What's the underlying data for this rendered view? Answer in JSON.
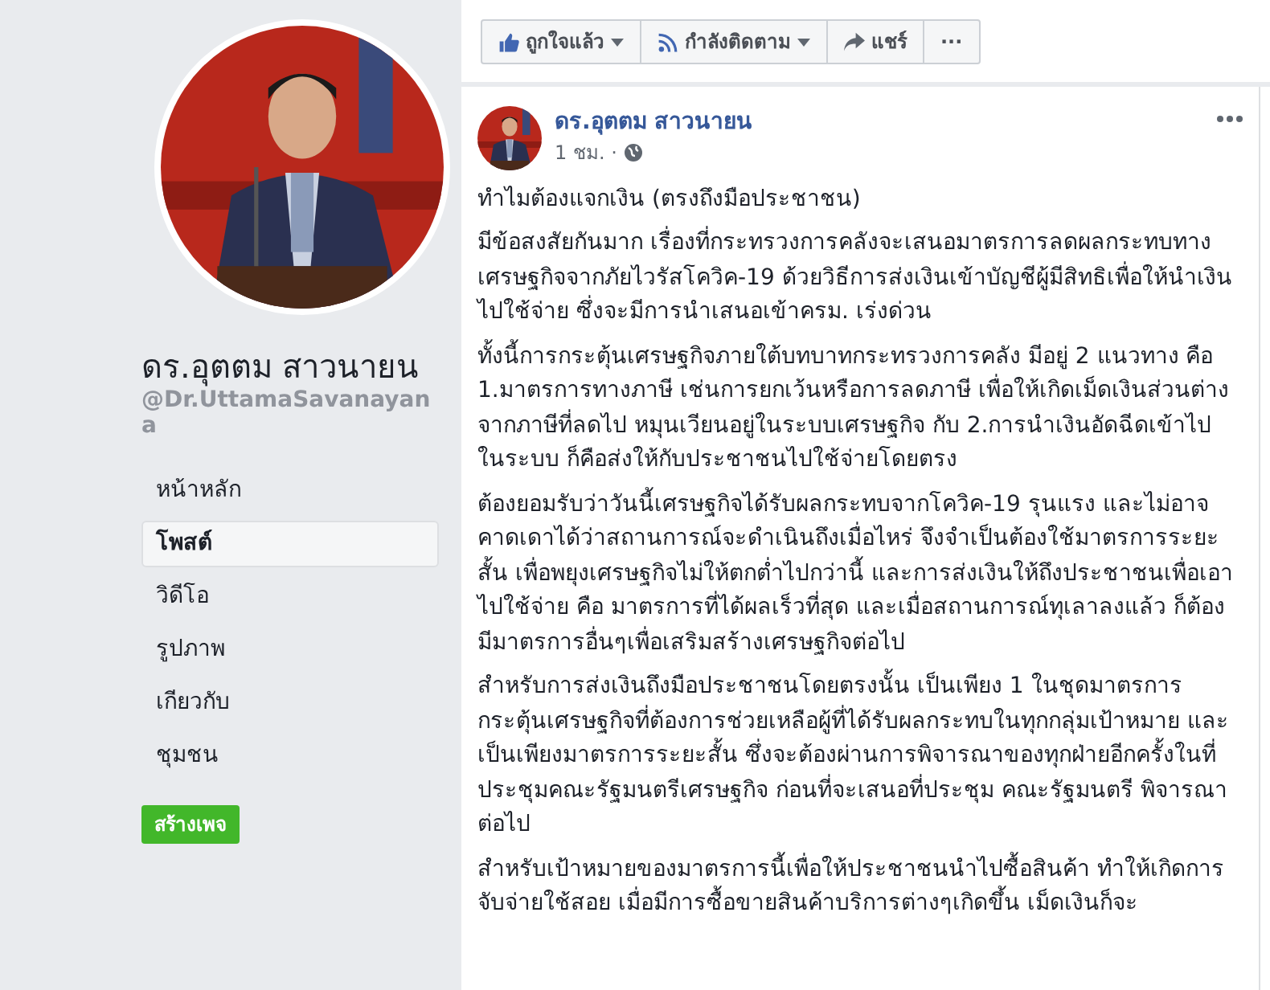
{
  "profile": {
    "name": "ดร.อุตตม สาวนายน",
    "handle": "@Dr.UttamaSavanayana"
  },
  "nav": [
    {
      "label": "หน้าหลัก",
      "selected": false
    },
    {
      "label": "โพสต์",
      "selected": true
    },
    {
      "label": "วิดีโอ",
      "selected": false
    },
    {
      "label": "รูปภาพ",
      "selected": false
    },
    {
      "label": "เกียวกับ",
      "selected": false
    },
    {
      "label": "ชุมชน",
      "selected": false
    }
  ],
  "create_page_button": "สร้างเพจ",
  "actions": [
    {
      "kind": "like",
      "label": "ถูกใจแล้ว",
      "dropdown": true
    },
    {
      "kind": "follow",
      "label": "กำลังติดตาม",
      "dropdown": true
    },
    {
      "kind": "share",
      "label": "แชร์",
      "dropdown": false
    },
    {
      "kind": "more",
      "label": "···",
      "dropdown": false
    }
  ],
  "post": {
    "author": "ดร.อุตตม สาวนายน",
    "time": "1 ชม. ·",
    "title": "ทำไมต้องแจกเงิน (ตรงถึงมือประชาชน)",
    "paragraphs": [
      "มีข้อสงสัยกันมาก เรื่องที่กระทรวงการคลังจะเสนอมาตรการลดผลกระทบทางเศรษฐกิจจากภัยไวรัสโควิค-19 ด้วยวิธีการส่งเงินเข้าบัญชีผู้มีสิทธิเพื่อให้นำเงินไปใช้จ่าย ซึ่งจะมีการนำเสนอเข้าครม. เร่งด่วน",
      "ทั้งนี้การกระตุ้นเศรษฐกิจภายใต้บทบาทกระทรวงการคลัง มีอยู่ 2 แนวทาง คือ 1.มาตรการทางภาษี เช่นการยกเว้นหรือการลดภาษี เพื่อให้เกิดเม็ดเงินส่วนต่างจากภาษีที่ลดไป หมุนเวียนอยู่ในระบบเศรษฐกิจ กับ 2.การนำเงินอัดฉีดเข้าไปในระบบ ก็คือส่งให้กับประชาชนไปใช้จ่ายโดยตรง",
      "ต้องยอมรับว่าวันนี้เศรษฐกิจได้รับผลกระทบจากโควิค-19 รุนแรง และไม่อาจคาดเดาได้ว่าสถานการณ์จะดำเนินถึงเมื่อไหร่ จึงจำเป็นต้องใช้มาตรการระยะสั้น เพื่อพยุงเศรษฐกิจไม่ให้ตกต่ำไปกว่านี้ และการส่งเงินให้ถึงประชาชนเพื่อเอาไปใช้จ่าย คือ มาตรการที่ได้ผลเร็วที่สุด และเมื่อสถานการณ์ทุเลาลงแล้ว ก็ต้องมีมาตรการอื่นๆเพื่อเสริมสร้างเศรษฐกิจต่อไป",
      "สำหรับการส่งเงินถึงมือประชาชนโดยตรงนั้น เป็นเพียง 1 ในชุดมาตรการกระตุ้นเศรษฐกิจที่ต้องการช่วยเหลือผู้ที่ได้รับผลกระทบในทุกกลุ่มเป้าหมาย และเป็นเพียงมาตรการระยะสั้น ซึ่งจะต้องผ่านการพิจารณาของทุกฝ่ายอีกครั้งในที่ประชุมคณะรัฐมนตรีเศรษฐกิจ ก่อนที่จะเสนอที่ประชุม คณะรัฐมนตรี พิจารณาต่อไป",
      "สำหรับเป้าหมายของมาตรการนี้เพื่อให้ประชาชนนำไปซื้อสินค้า ทำให้เกิดการจับจ่ายใช้สอย เมื่อมีการซื้อขายสินค้าบริการต่างๆเกิดขึ้น เม็ดเงินก็จะ"
    ]
  }
}
